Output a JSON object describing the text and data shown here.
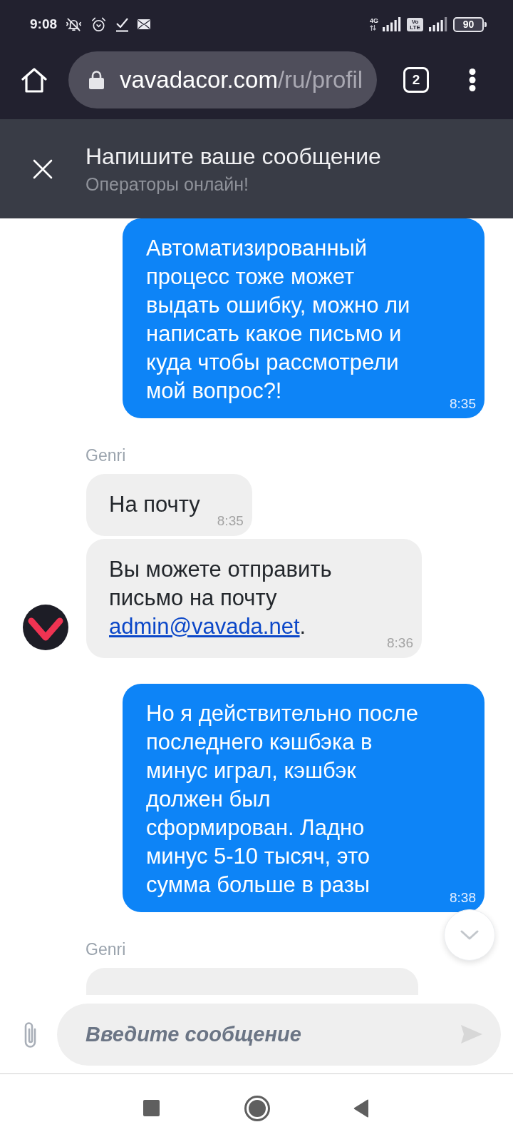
{
  "status_bar": {
    "time": "9:08",
    "network_type": "4G",
    "volte_badge": "Vo LTE",
    "battery": "90"
  },
  "browser": {
    "url_host": "vavadacor.com",
    "url_path": "/ru/profil",
    "tab_count": "2"
  },
  "chat_header": {
    "title": "Напишите ваше сообщение",
    "subtitle": "Операторы онлайн!"
  },
  "messages": [
    {
      "kind": "outgoing",
      "text": "Автоматизированный процесс тоже может выдать ошибку, можно ли написать какое письмо и куда чтобы рассмотрели мой вопрос?!",
      "time": "8:35"
    },
    {
      "kind": "sender",
      "name": "Genri"
    },
    {
      "kind": "incoming",
      "text": "На почту",
      "time": "8:35",
      "avatar": false
    },
    {
      "kind": "incoming",
      "text": "Вы можете отправить письмо на почту",
      "link": "admin@vavada.net",
      "text_end": ".",
      "time": "8:36",
      "avatar": true
    },
    {
      "kind": "outgoing",
      "text": "Но я действительно после последнего кэшбэка в минус играл, кэшбэк должен был сформирован. Ладно минус 5-10 тысяч, это сумма больше в разы",
      "time": "8:38"
    },
    {
      "kind": "sender",
      "name": "Genri"
    },
    {
      "kind": "incoming",
      "avatar": false
    }
  ],
  "composer": {
    "placeholder": "Введите сообщение"
  }
}
